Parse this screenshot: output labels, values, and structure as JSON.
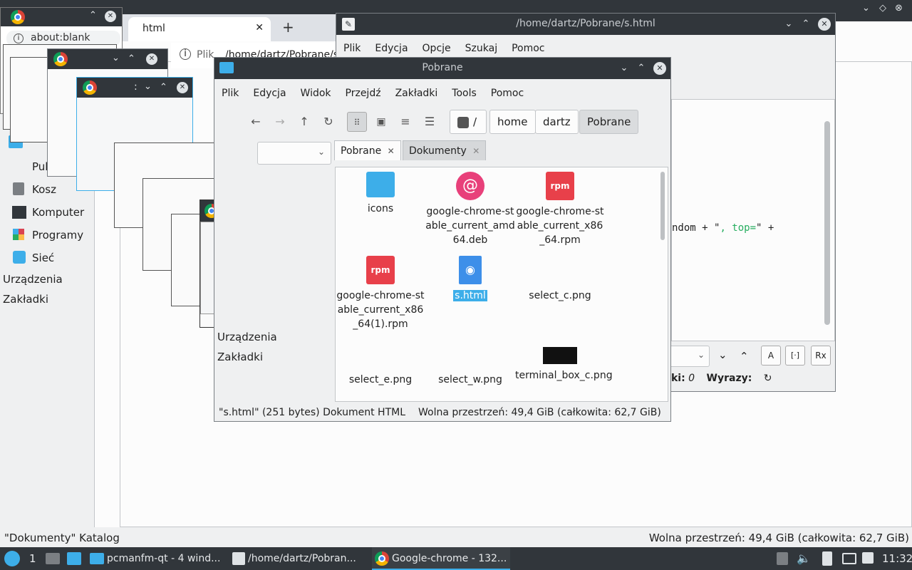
{
  "desktop_top_bar": {
    "text": ""
  },
  "back_window": {
    "sidebar": {
      "items": [
        {
          "label": "Pulpit"
        },
        {
          "label": "Kosz"
        },
        {
          "label": "Komputer"
        },
        {
          "label": "Programy"
        },
        {
          "label": "Sieć"
        }
      ],
      "sections": [
        "Urządzenia",
        "Zakładki"
      ]
    },
    "status_left": "\"Dokumenty\" Katalog",
    "status_right": "Wolna przestrzeń: 49,4 GiB (całkowita: 62,7 GiB)"
  },
  "chrome_small": {
    "address": "about:blank",
    "tab_label": "html",
    "tab2_label": "Plik",
    "url_text": "/home/dartz/Pobrane/s"
  },
  "editor": {
    "title": "/home/dartz/Pobrane/s.html",
    "menu": [
      "Plik",
      "Edycja",
      "Opcje",
      "Szukaj",
      "Pomoc"
    ],
    "code_a": "ndom + \"",
    "code_b": ", top=",
    "code_c": "\" +",
    "status_lines_label": "ki:",
    "status_lines_value": "0",
    "status_words_label": "Wyrazy:"
  },
  "filemanager": {
    "title": "Pobrane",
    "menu": [
      "Plik",
      "Edycja",
      "Widok",
      "Przejdź",
      "Zakładki",
      "Tools",
      "Pomoc"
    ],
    "breadcrumb": [
      "/",
      "home",
      "dartz",
      "Pobrane"
    ],
    "tabs": [
      {
        "label": "Pobrane"
      },
      {
        "label": "Dokumenty"
      }
    ],
    "sidebar_sections": [
      "Urządzenia",
      "Zakładki"
    ],
    "files": [
      {
        "name": "icons",
        "icon": "folder-icon"
      },
      {
        "name": "google-chrome-stable_current_amd64.deb",
        "icon": "debian-icon"
      },
      {
        "name": "google-chrome-stable_current_x86_64.rpm",
        "icon": "rpm-icon"
      },
      {
        "name": "google-chrome-stable_current_x86_64(1).rpm",
        "icon": "rpm-icon"
      },
      {
        "name": "s.html",
        "icon": "html-file-icon"
      },
      {
        "name": "select_c.png",
        "icon": "image-icon"
      },
      {
        "name": "select_e.png",
        "icon": "image-icon"
      },
      {
        "name": "select_w.png",
        "icon": "image-icon"
      },
      {
        "name": "terminal_box_c.png",
        "icon": "image-icon"
      }
    ],
    "status_left": "\"s.html\" (251 bytes) Dokument HTML",
    "status_right": "Wolna przestrzeń: 49,4 GiB (całkowita: 62,7 GiB)"
  },
  "cascade_window": {
    "title_char": ":"
  },
  "taskbar": {
    "desktop_number": "1",
    "tasks": [
      {
        "label": "pcmanfm-qt - 4 wind..."
      },
      {
        "label": "/home/dartz/Pobran..."
      },
      {
        "label": "Google-chrome - 132..."
      }
    ],
    "clock": "11:32"
  },
  "colors": {
    "titlebar": "#31363b",
    "accent": "#3daee9",
    "selection": "#3daee9"
  }
}
